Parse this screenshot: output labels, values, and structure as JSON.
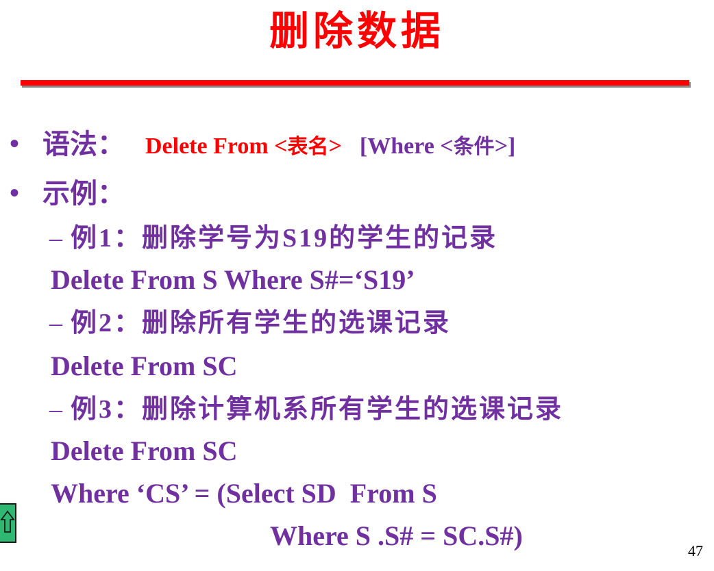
{
  "slide": {
    "title": "删除数据",
    "page_number": "47"
  },
  "syntax": {
    "label": "语法：",
    "delete_from": "Delete From <",
    "table_name": "表名",
    "close": ">",
    "where_open": "[Where <",
    "condition": "条件",
    "where_close": ">]"
  },
  "examples": {
    "label": "示例：",
    "ex1_title": "例1：删除学号为S19的学生的记录",
    "ex1_code": "Delete From S Where S#=‘S19’",
    "ex2_title": "例2：删除所有学生的选课记录",
    "ex2_code": "Delete From SC",
    "ex3_title": "例3：删除计算机系所有学生的选课记录",
    "ex3_code_1": "Delete From SC",
    "ex3_code_2": "Where ‘CS’ = (Select SD  From S",
    "ex3_code_3": "Where S .S# = SC.S#)"
  },
  "colors": {
    "title": "#ff0000",
    "text": "#7030a0",
    "nav_button": "#2eb872"
  }
}
